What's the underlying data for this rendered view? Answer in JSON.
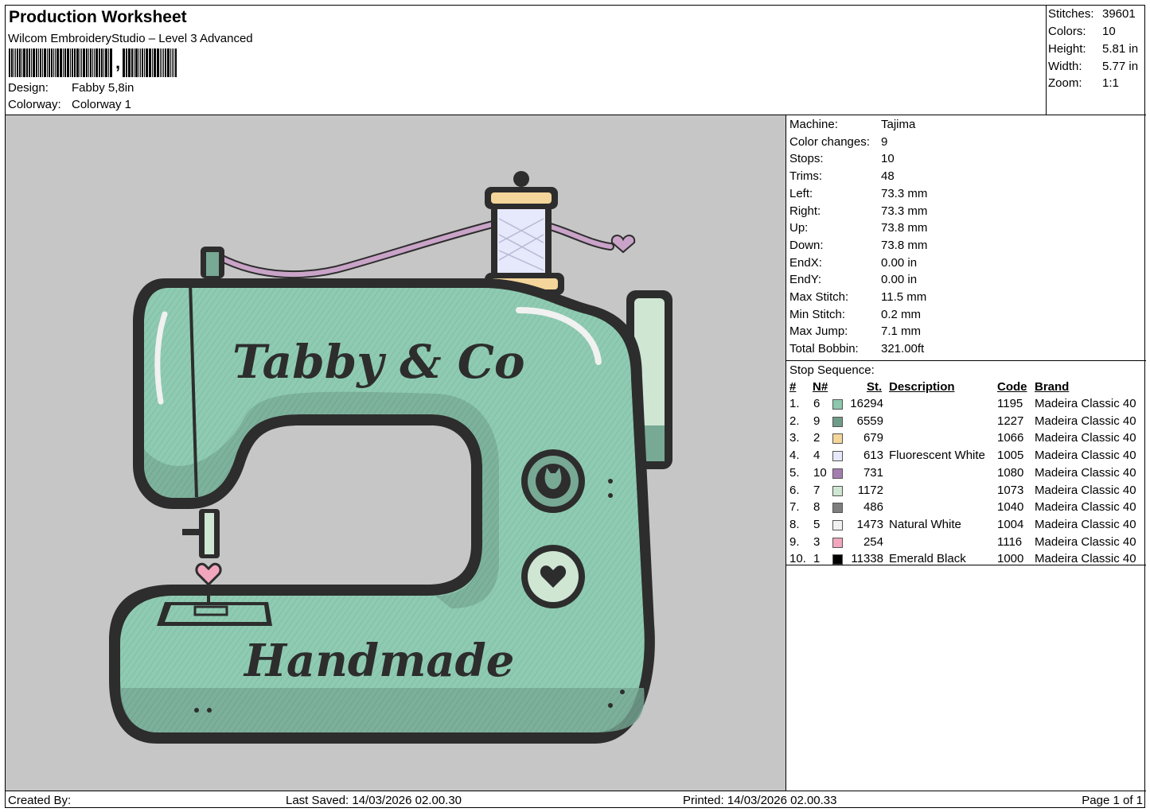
{
  "header": {
    "title": "Production Worksheet",
    "subtitle": "Wilcom EmbroideryStudio – Level 3 Advanced",
    "design_label": "Design:",
    "design_value": "Fabby 5,8in",
    "colorway_label": "Colorway:",
    "colorway_value": "Colorway 1"
  },
  "stats": [
    {
      "label": "Stitches:",
      "value": "39601"
    },
    {
      "label": "Colors:",
      "value": "10"
    },
    {
      "label": "Height:",
      "value": "5.81 in"
    },
    {
      "label": "Width:",
      "value": "5.77 in"
    },
    {
      "label": "Zoom:",
      "value": "1:1"
    }
  ],
  "preview": {
    "top_text": "Tabby & Co",
    "bottom_text": "Handmade"
  },
  "machine_info": [
    {
      "label": "Machine:",
      "value": "Tajima"
    },
    {
      "label": "Color changes:",
      "value": "9"
    },
    {
      "label": "Stops:",
      "value": "10"
    },
    {
      "label": "Trims:",
      "value": "48"
    },
    {
      "label": "Left:",
      "value": "73.3 mm"
    },
    {
      "label": "Right:",
      "value": "73.3 mm"
    },
    {
      "label": "Up:",
      "value": "73.8 mm"
    },
    {
      "label": "Down:",
      "value": "73.8 mm"
    },
    {
      "label": "EndX:",
      "value": "0.00 in"
    },
    {
      "label": "EndY:",
      "value": "0.00 in"
    },
    {
      "label": "Max Stitch:",
      "value": "11.5 mm"
    },
    {
      "label": "Min Stitch:",
      "value": "0.2 mm"
    },
    {
      "label": "Max Jump:",
      "value": "7.1 mm"
    },
    {
      "label": "Total Bobbin:",
      "value": "321.00ft"
    }
  ],
  "stop_sequence": {
    "title": "Stop Sequence:",
    "headers": {
      "num": "#",
      "n": "N#",
      "st": "St.",
      "desc": "Description",
      "code": "Code",
      "brand": "Brand"
    },
    "rows": [
      {
        "num": "1.",
        "n": "6",
        "color": "#8cc7ae",
        "st": "16294",
        "desc": "",
        "code": "1195",
        "brand": "Madeira Classic 40"
      },
      {
        "num": "2.",
        "n": "9",
        "color": "#6f9b89",
        "st": "6559",
        "desc": "",
        "code": "1227",
        "brand": "Madeira Classic 40"
      },
      {
        "num": "3.",
        "n": "2",
        "color": "#f4d59a",
        "st": "679",
        "desc": "",
        "code": "1066",
        "brand": "Madeira Classic 40"
      },
      {
        "num": "4.",
        "n": "4",
        "color": "#e6e8fb",
        "st": "613",
        "desc": "Fluorescent White",
        "code": "1005",
        "brand": "Madeira Classic 40"
      },
      {
        "num": "5.",
        "n": "10",
        "color": "#a47db0",
        "st": "731",
        "desc": "",
        "code": "1080",
        "brand": "Madeira Classic 40"
      },
      {
        "num": "6.",
        "n": "7",
        "color": "#cfe6d3",
        "st": "1172",
        "desc": "",
        "code": "1073",
        "brand": "Madeira Classic 40"
      },
      {
        "num": "7.",
        "n": "8",
        "color": "#7e7e7e",
        "st": "486",
        "desc": "",
        "code": "1040",
        "brand": "Madeira Classic 40"
      },
      {
        "num": "8.",
        "n": "5",
        "color": "#f1f1f1",
        "st": "1473",
        "desc": "Natural White",
        "code": "1004",
        "brand": "Madeira Classic 40"
      },
      {
        "num": "9.",
        "n": "3",
        "color": "#f2a6bd",
        "st": "254",
        "desc": "",
        "code": "1116",
        "brand": "Madeira Classic 40"
      },
      {
        "num": "10.",
        "n": "1",
        "color": "#000000",
        "st": "11338",
        "desc": "Emerald Black",
        "code": "1000",
        "brand": "Madeira Classic 40"
      }
    ]
  },
  "footer": {
    "created_by": "Created By:",
    "last_saved": "Last Saved: 14/03/2026 02.00.30",
    "printed": "Printed: 14/03/2026 02.00.33",
    "page": "Page 1 of 1"
  }
}
